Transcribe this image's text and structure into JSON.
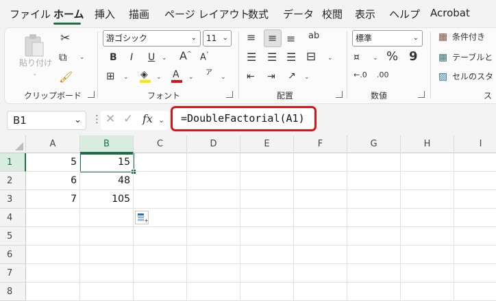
{
  "menu": {
    "tabs": [
      {
        "label": "ファイル"
      },
      {
        "label": "ホーム"
      },
      {
        "label": "挿入"
      },
      {
        "label": "描画"
      },
      {
        "label": "ページ レイアウト"
      },
      {
        "label": "数式"
      },
      {
        "label": "データ"
      },
      {
        "label": "校閲"
      },
      {
        "label": "表示"
      },
      {
        "label": "ヘルプ"
      },
      {
        "label": "Acrobat"
      }
    ],
    "active_index": 1,
    "accent_color": "#1f6e43"
  },
  "ribbon": {
    "clipboard": {
      "paste_label": "貼り付け",
      "group_label": "クリップボード"
    },
    "font": {
      "font_name": "游ゴシック",
      "font_size": "11",
      "bold": "B",
      "italic": "I",
      "underline": "U",
      "grow": "A",
      "shrink": "A",
      "phonetic": "ア",
      "group_label": "フォント"
    },
    "alignment": {
      "group_label": "配置"
    },
    "number": {
      "format": "標準",
      "percent": "%",
      "comma": "9",
      "group_label": "数値"
    },
    "styles": {
      "conditional": "条件付き",
      "table": "テーブルと",
      "cell": "セルのスタ",
      "group_label": "ス"
    }
  },
  "formula_bar": {
    "name_box": "B1",
    "fx": "fx",
    "formula": "=DoubleFactorial(A1)",
    "highlight_color": "#e01010"
  },
  "sheet": {
    "columns": [
      "A",
      "B",
      "C",
      "D",
      "E",
      "F",
      "G",
      "H",
      "I"
    ],
    "selected_column": "B",
    "rows": [
      {
        "num": "1",
        "A": "5",
        "B": "15"
      },
      {
        "num": "2",
        "A": "6",
        "B": "48"
      },
      {
        "num": "3",
        "A": "7",
        "B": "105"
      },
      {
        "num": "4",
        "A": "",
        "B": ""
      },
      {
        "num": "5",
        "A": "",
        "B": ""
      },
      {
        "num": "6",
        "A": "",
        "B": ""
      },
      {
        "num": "7",
        "A": "",
        "B": ""
      },
      {
        "num": "8",
        "A": "",
        "B": ""
      }
    ],
    "active_cell": "B1"
  }
}
